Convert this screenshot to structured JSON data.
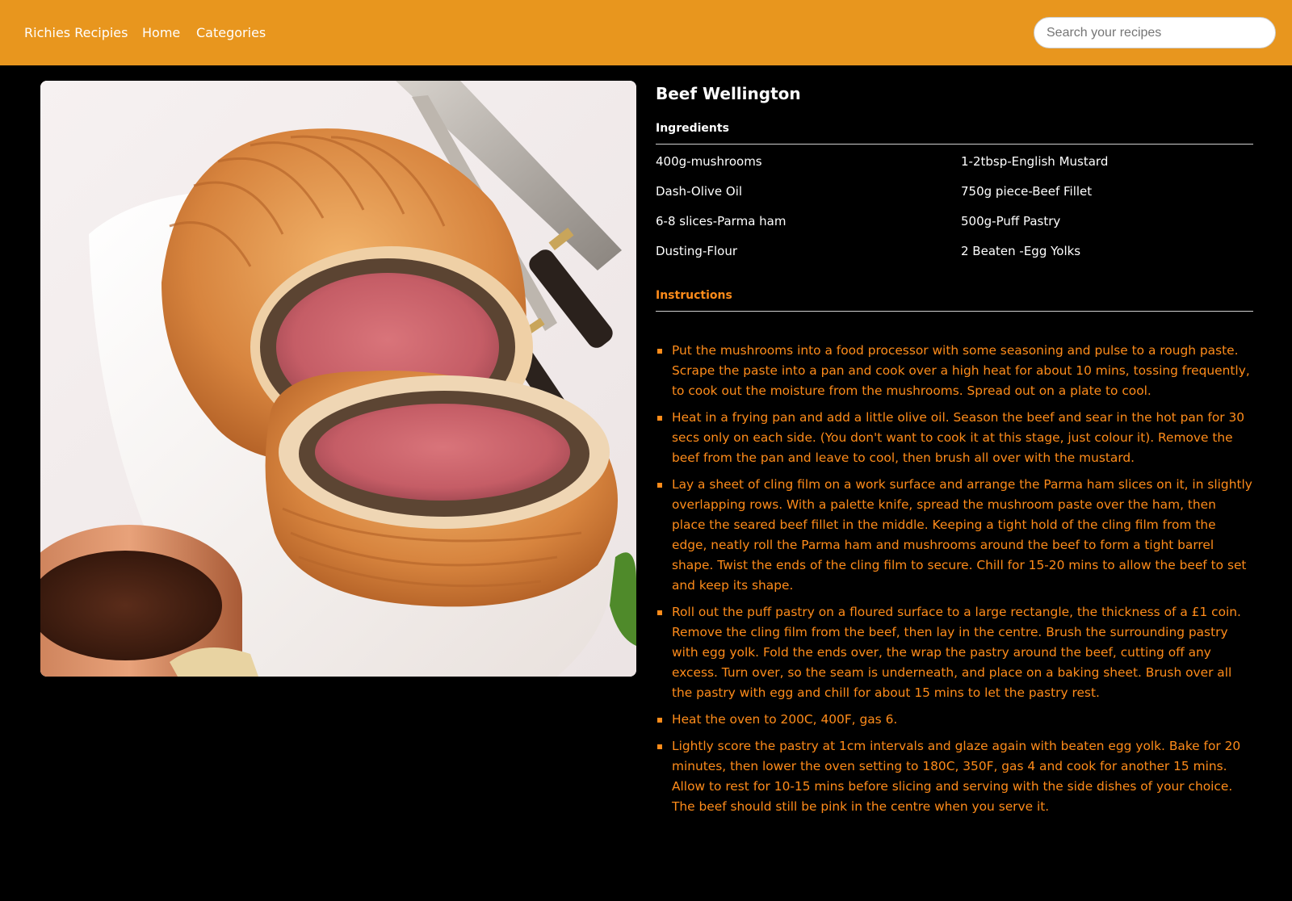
{
  "nav": {
    "brand": "Richies Recipies",
    "links": [
      "Home",
      "Categories"
    ],
    "search_placeholder": "Search your recipes"
  },
  "recipe": {
    "title": "Beef Wellington",
    "image_alt": "Beef Wellington",
    "ingredients_heading": "Ingredients",
    "ingredients": [
      "400g-mushrooms",
      "1-2tbsp-English Mustard",
      "Dash-Olive Oil",
      "750g piece-Beef Fillet",
      "6-8 slices-Parma ham",
      "500g-Puff Pastry",
      "Dusting-Flour",
      "2 Beaten -Egg Yolks"
    ],
    "instructions_heading": "Instructions",
    "instructions": [
      "Put the mushrooms into a food processor with some seasoning and pulse to a rough paste. Scrape the paste into a pan and cook over a high heat for about 10 mins, tossing frequently, to cook out the moisture from the mushrooms. Spread out on a plate to cool.",
      "Heat in a frying pan and add a little olive oil. Season the beef and sear in the hot pan for 30 secs only on each side. (You don't want to cook it at this stage, just colour it). Remove the beef from the pan and leave to cool, then brush all over with the mustard.",
      "Lay a sheet of cling film on a work surface and arrange the Parma ham slices on it, in slightly overlapping rows. With a palette knife, spread the mushroom paste over the ham, then place the seared beef fillet in the middle. Keeping a tight hold of the cling film from the edge, neatly roll the Parma ham and mushrooms around the beef to form a tight barrel shape. Twist the ends of the cling film to secure. Chill for 15-20 mins to allow the beef to set and keep its shape.",
      "Roll out the puff pastry on a floured surface to a large rectangle, the thickness of a £1 coin. Remove the cling film from the beef, then lay in the centre. Brush the surrounding pastry with egg yolk. Fold the ends over, the wrap the pastry around the beef, cutting off any excess. Turn over, so the seam is underneath, and place on a baking sheet. Brush over all the pastry with egg and chill for about 15 mins to let the pastry rest.",
      "Heat the oven to 200C, 400F, gas 6.",
      "Lightly score the pastry at 1cm intervals and glaze again with beaten egg yolk. Bake for 20 minutes, then lower the oven setting to 180C, 350F, gas 4 and cook for another 15 mins. Allow to rest for 10-15 mins before slicing and serving with the side dishes of your choice. The beef should still be pink in the centre when you serve it."
    ]
  },
  "colors": {
    "navbar": "#e8961e",
    "background": "#000000",
    "accent": "#ff8c1a",
    "text": "#ffffff"
  }
}
